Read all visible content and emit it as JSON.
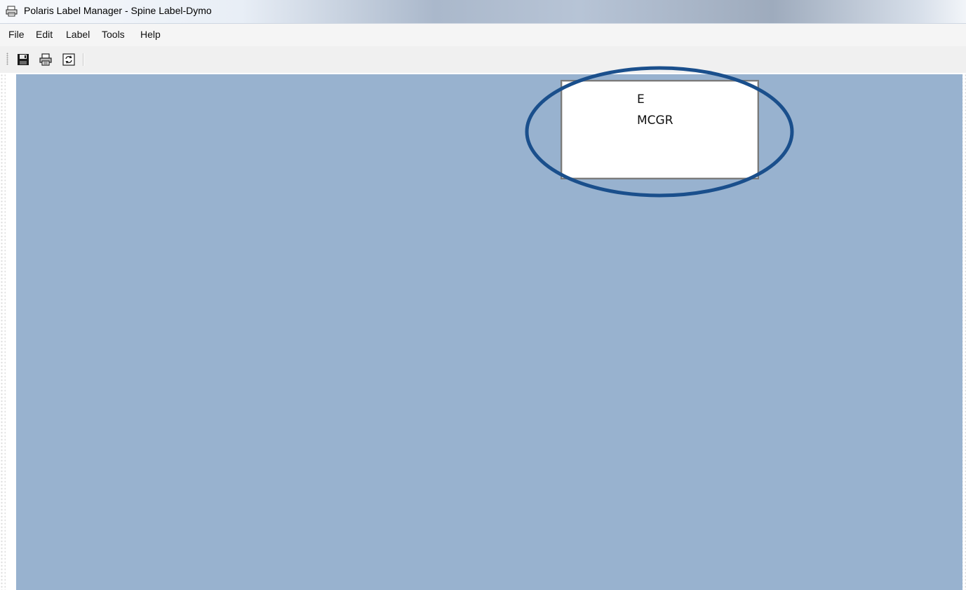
{
  "window": {
    "title": "Polaris Label Manager - Spine Label-Dymo",
    "app_icon": "printer-app-icon"
  },
  "menu": {
    "items": [
      {
        "label": "File"
      },
      {
        "label": "Edit"
      },
      {
        "label": "Label"
      },
      {
        "label": "Tools"
      },
      {
        "label": "Help"
      }
    ]
  },
  "toolbar": {
    "buttons": [
      {
        "icon": "save-icon"
      },
      {
        "icon": "print-icon"
      },
      {
        "icon": "refresh-icon"
      }
    ]
  },
  "label_preview": {
    "lines": [
      "E",
      "MCGR"
    ]
  },
  "colors": {
    "workspace": "#98b2cf",
    "annotation": "#1a4f8c"
  }
}
